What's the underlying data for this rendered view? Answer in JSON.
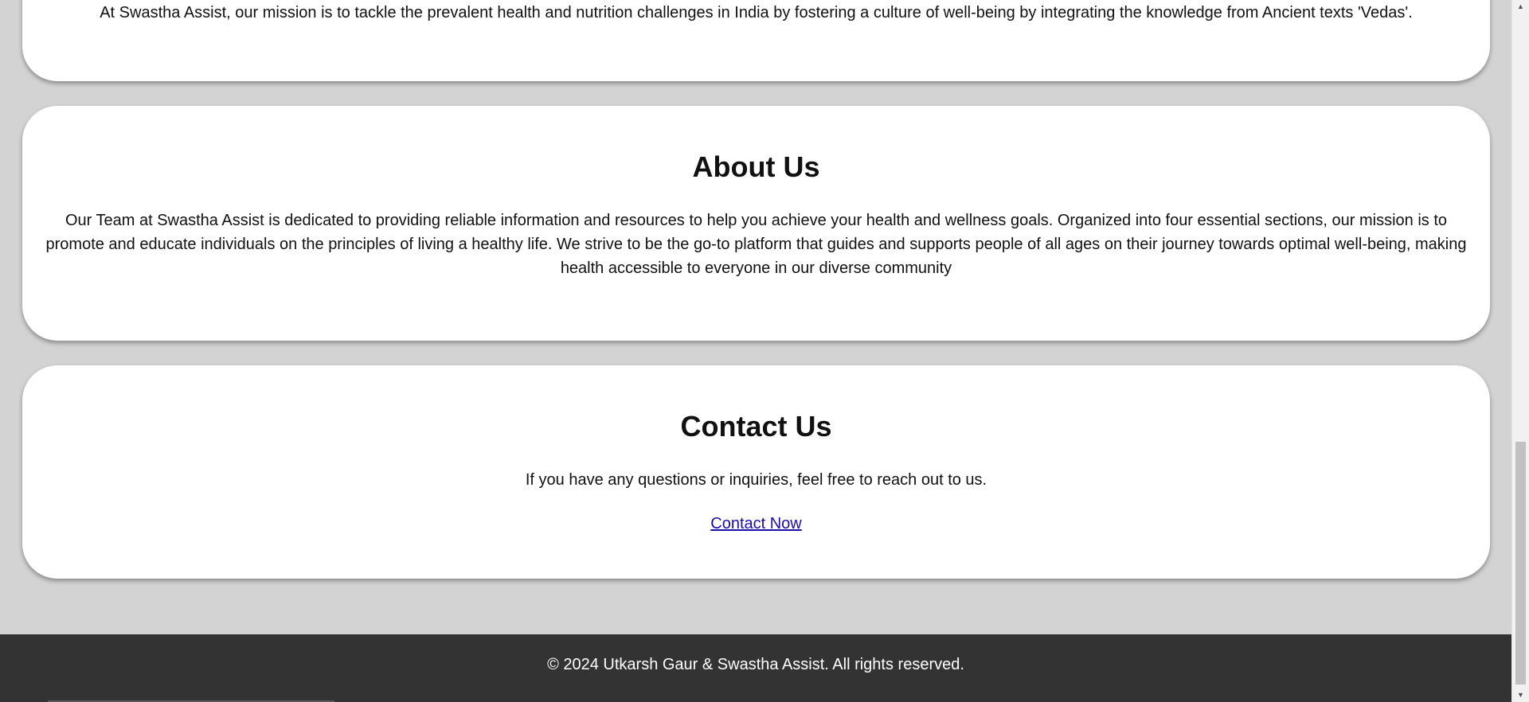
{
  "mission": {
    "text": "At Swastha Assist, our mission is to tackle the prevalent health and nutrition challenges in India by fostering a culture of well-being by integrating the knowledge from Ancient texts 'Vedas'."
  },
  "about": {
    "title": "About Us",
    "text": "Our Team at Swastha Assist is dedicated to providing reliable information and resources to help you achieve your health and wellness goals. Organized into four essential sections, our mission is to promote and educate individuals on the principles of living a healthy life. We strive to be the go-to platform that guides and supports people of all ages on their journey towards optimal well-being, making health accessible to everyone in our diverse community"
  },
  "contact": {
    "title": "Contact Us",
    "text": "If you have any questions or inquiries, feel free to reach out to us.",
    "link_label": "Contact Now"
  },
  "footer": {
    "text": "© 2024 Utkarsh Gaur & Swastha Assist. All rights reserved."
  },
  "scrollbar": {
    "up_icon": "▲",
    "down_icon": "▼"
  },
  "colors": {
    "page_background": "#d3d3d3",
    "card_background": "#ffffff",
    "footer_background": "#333333",
    "link": "#1a0dab"
  }
}
